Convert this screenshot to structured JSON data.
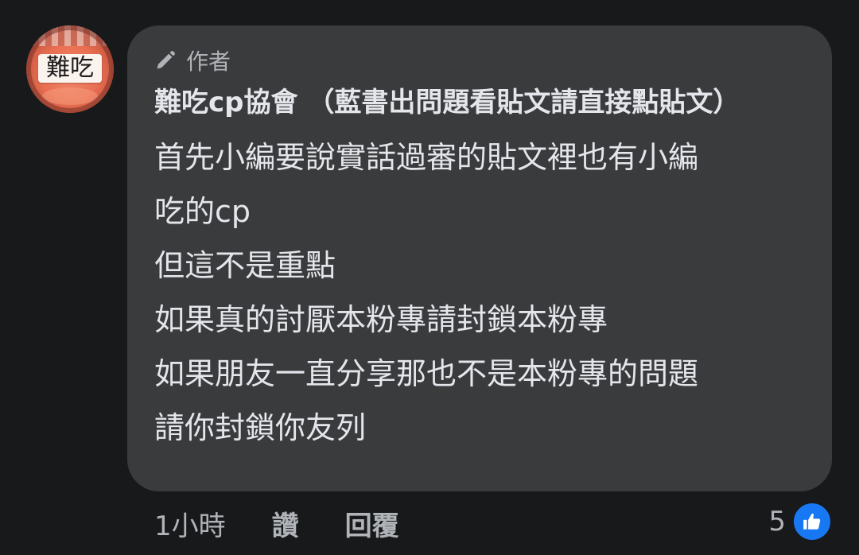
{
  "avatar": {
    "text": "難吃"
  },
  "comment": {
    "author_badge": "作者",
    "poster_name": "難吃cp協會 （藍書出問題看貼文請直接點貼文）",
    "lines": [
      "首先小編要說實話過審的貼文裡也有小編",
      "吃的cp",
      "但這不是重點",
      "如果真的討厭本粉專請封鎖本粉專",
      "如果朋友一直分享那也不是本粉專的問題",
      "請你封鎖你友列"
    ]
  },
  "actions": {
    "time": "1小時",
    "like_label": "讚",
    "reply_label": "回覆"
  },
  "reactions": {
    "count": "5",
    "icon": "thumbs-up-icon",
    "icon_color": "#1877f2"
  },
  "colors": {
    "background": "#18191a",
    "bubble": "#3a3b3c",
    "primary_text": "#e4e6eb",
    "secondary_text": "#b0b3b8"
  }
}
